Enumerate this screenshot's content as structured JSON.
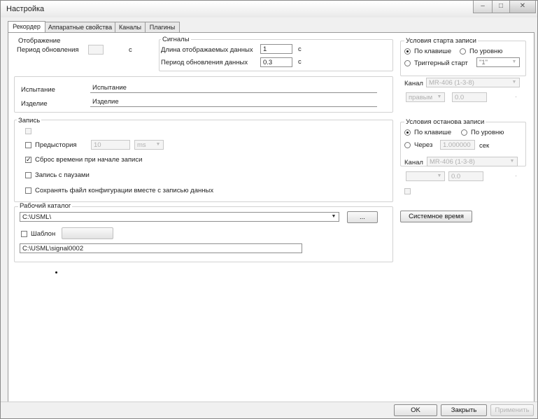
{
  "window": {
    "title": "Настройка",
    "controls": {
      "minimize": "–",
      "maximize": "□",
      "close": "✕"
    }
  },
  "tabs": [
    "Рекордер",
    "Аппаратные свойства",
    "Каналы",
    "Плагины"
  ],
  "display": {
    "group_label": "Отображение",
    "period_label": "Период обновления",
    "period_value": "",
    "period_unit": "с"
  },
  "signals": {
    "group_label": "Сигналы",
    "length_label": "Длина отображаемых данных",
    "length_value": "1",
    "length_unit": "с",
    "update_label": "Период обновления данных",
    "update_value": "0.3",
    "update_unit": "с"
  },
  "test": {
    "test_label": "Испытание",
    "test_value": "Испытание",
    "product_label": "Изделие",
    "product_value": "Изделие"
  },
  "record": {
    "group_label": "Запись",
    "option1_label": "",
    "prehistory_label": "Предыстория",
    "prehistory_value": "10",
    "prehistory_unit": "ms",
    "reset_time_label": "Сброс времени при начале записи",
    "pauses_label": "Запись с паузами",
    "save_config_label": "Сохранять файл конфигурации вместе с записью данных"
  },
  "workdir": {
    "group_label": "Рабочий каталог",
    "path_value": "C:\\USML\\",
    "browse_label": "...",
    "template_label": "Шаблон",
    "template_button": "",
    "signal_path": "C:\\USML\\signal0002"
  },
  "start": {
    "group_label": "Условия старта записи",
    "by_key": "По клавише",
    "by_level": "По уровню",
    "trigger_label": "Триггерный старт",
    "trigger_value": "\"1\"",
    "channel_label": "Канал",
    "channel_value": "MR-406 (1-3-8)",
    "edge_value": "правым",
    "level_value": "0.0",
    "level_unit": "·"
  },
  "stop": {
    "group_label": "Условия останова записи",
    "by_key": "По клавише",
    "by_level": "По уровню",
    "after_label": "Через",
    "after_value": "1.000000",
    "after_unit": "сек",
    "channel_label": "Канал",
    "channel_value": "MR-406 (1-3-8)",
    "edge_value": "",
    "level_value": "0.0",
    "level_unit": "·",
    "disabled_check_label": ""
  },
  "system_time_button": "Системное время",
  "footer": {
    "ok": "OK",
    "close": "Закрыть",
    "apply": "Применить"
  }
}
